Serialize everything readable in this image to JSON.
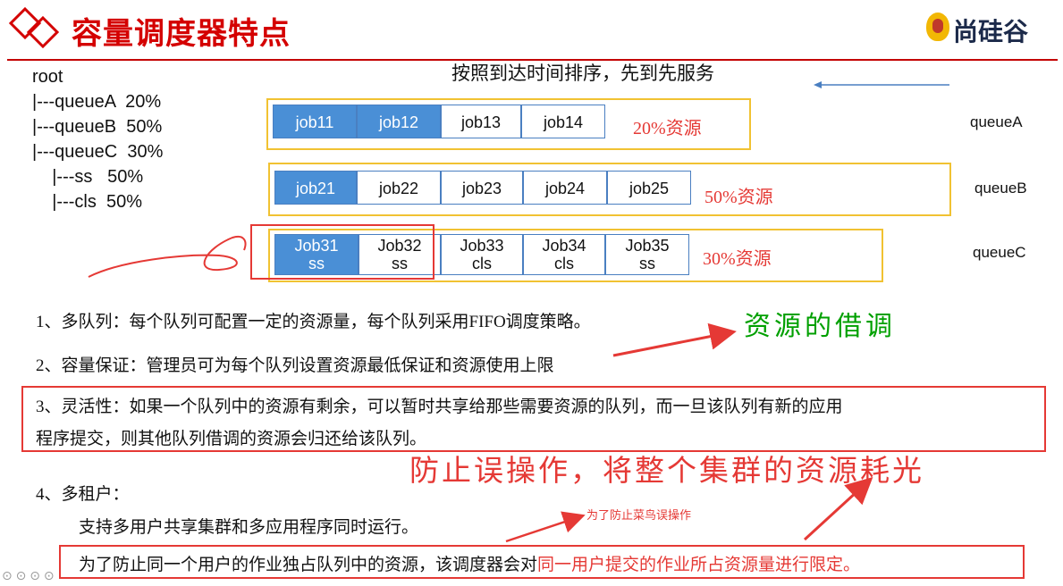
{
  "header": {
    "title": "容量调度器特点",
    "logo_text": "尚硅谷"
  },
  "tree": {
    "lines": [
      "root",
      "|---queueA  20%",
      "|---queueB  50%",
      "|---queueC  30%",
      "    |---ss   50%",
      "    |---cls  50%"
    ]
  },
  "caption": "按照到达时间排序，先到先服务",
  "queues": [
    {
      "label": "queueA",
      "resource": "20%资源",
      "jobs": [
        {
          "l1": "job11",
          "l2": "",
          "blue": true
        },
        {
          "l1": "job12",
          "l2": "",
          "blue": true
        },
        {
          "l1": "job13",
          "l2": "",
          "blue": false
        },
        {
          "l1": "job14",
          "l2": "",
          "blue": false
        }
      ]
    },
    {
      "label": "queueB",
      "resource": "50%资源",
      "jobs": [
        {
          "l1": "job21",
          "l2": "",
          "blue": true
        },
        {
          "l1": "job22",
          "l2": "",
          "blue": false
        },
        {
          "l1": "job23",
          "l2": "",
          "blue": false
        },
        {
          "l1": "job24",
          "l2": "",
          "blue": false
        },
        {
          "l1": "job25",
          "l2": "",
          "blue": false
        }
      ]
    },
    {
      "label": "queueC",
      "resource": "30%资源",
      "jobs": [
        {
          "l1": "Job31",
          "l2": "ss",
          "blue": true
        },
        {
          "l1": "Job32",
          "l2": "ss",
          "blue": false
        },
        {
          "l1": "Job33",
          "l2": "cls",
          "blue": false
        },
        {
          "l1": "Job34",
          "l2": "cls",
          "blue": false
        },
        {
          "l1": "Job35",
          "l2": "ss",
          "blue": false
        }
      ]
    }
  ],
  "points": {
    "p1": "1、多队列：每个队列可配置一定的资源量，每个队列采用FIFO调度策略。",
    "p2": "2、容量保证：管理员可为每个队列设置资源最低保证和资源使用上限",
    "p3_line1": "3、灵活性：如果一个队列中的资源有剩余，可以暂时共享给那些需要资源的队列，而一旦该队列有新的应用",
    "p3_line2": "程序提交，则其他队列借调的资源会归还给该队列。",
    "p4": "4、多租户：",
    "p4_sub1": "支持多用户共享集群和多应用程序同时运行。",
    "p4_sub2_prefix": "为了防止同一个用户的作业独占队列中的资源，该调度器会对",
    "p4_sub2_red": "同一用户提交的作业所占资源量进行限定。"
  },
  "annotations": {
    "borrow": "资源的借调",
    "prevent": "防止误操作，将整个集群的资源耗光",
    "newbie": "为了防止菜鸟误操作"
  },
  "colors": {
    "title_red": "#d40000",
    "job_blue": "#4a8fd6",
    "queue_border": "#f1c232",
    "annotation_red": "#e53935",
    "annotation_green": "#00a000"
  }
}
